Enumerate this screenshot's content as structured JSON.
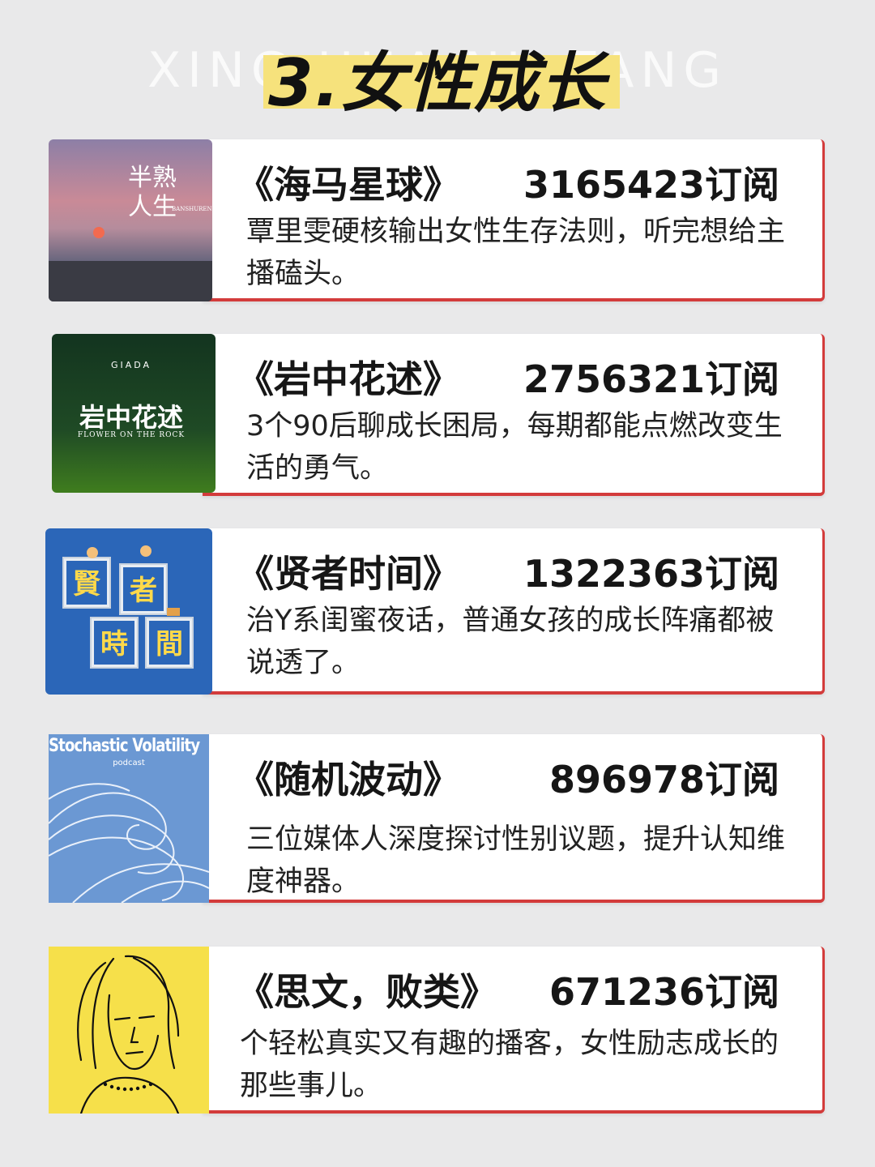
{
  "watermark": "XING HUA NU FANG",
  "title": "3.女性成长",
  "cards": [
    {
      "name": "《海马星球》",
      "subs": "3165423订阅",
      "desc": "覃里雯硬核输出女性生存法则，听完想给主播磕头。",
      "cover": {
        "big": "半熟\n人生",
        "small": "BANSHUREN"
      }
    },
    {
      "name": "《岩中花述》",
      "subs": "2756321订阅",
      "desc": "3个90后聊成长困局，每期都能点燃改变生活的勇气。",
      "cover": {
        "top": "GIADA",
        "big": "岩中花述",
        "small": "FLOWER ON THE ROCK"
      }
    },
    {
      "name": "《贤者时间》",
      "subs": "1322363订阅",
      "desc": "治Y系闺蜜夜话，普通女孩的成长阵痛都被说透了。",
      "cover": {
        "chars": [
          "賢",
          "者",
          "時",
          "間"
        ]
      }
    },
    {
      "name": "《随机波动》",
      "subs": "896978订阅",
      "desc": "三位媒体人深度探讨性别议题，提升认知维度神器。",
      "cover": {
        "big": "Stochastic Volatility",
        "small": "podcast"
      }
    },
    {
      "name": "《思文，败类》",
      "subs": "671236订阅",
      "desc": "个轻松真实又有趣的播客，女性励志成长的那些事儿。",
      "cover": {}
    }
  ],
  "colors": {
    "accent": "#d33b3b",
    "highlight": "#f6e27c",
    "background": "#e9e9ea"
  }
}
